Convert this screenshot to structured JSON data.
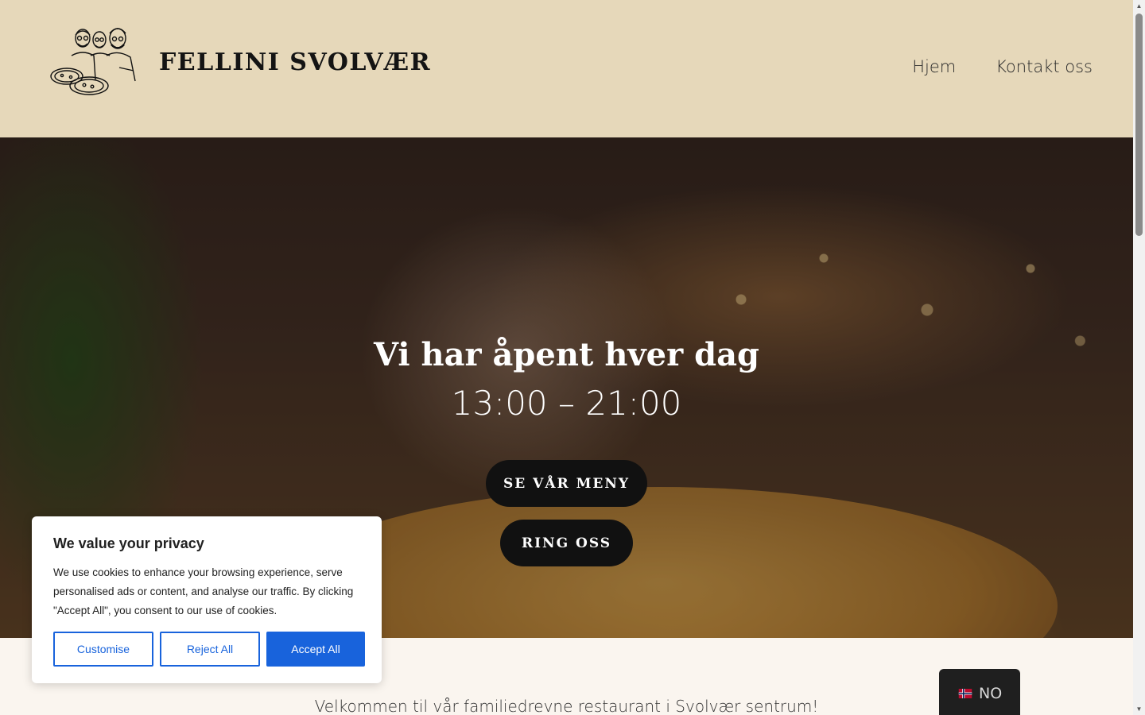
{
  "header": {
    "brand": "FELLINI SVOLVÆR",
    "nav": [
      {
        "label": "Hjem"
      },
      {
        "label": "Kontakt oss"
      }
    ]
  },
  "hero": {
    "title": "Vi har åpent hver dag",
    "hours": "13:00 – 21:00",
    "menu_button": "SE VÅR MENY",
    "call_button": "RING OSS"
  },
  "welcome": "Velkommen til vår familiedrevne restaurant i Svolvær sentrum!",
  "cookie_banner": {
    "title": "We value your privacy",
    "text": "We use cookies to enhance your browsing experience, serve personalised ads or content, and analyse our traffic. By clicking \"Accept All\", you consent to our use of cookies.",
    "customise": "Customise",
    "reject": "Reject All",
    "accept": "Accept All",
    "accent_color": "#1863dc"
  },
  "language_switcher": {
    "label": "NO",
    "flag_icon": "norway-flag-icon"
  },
  "colors": {
    "header_bg": "#e6d8ba",
    "button_bg": "#111111"
  }
}
